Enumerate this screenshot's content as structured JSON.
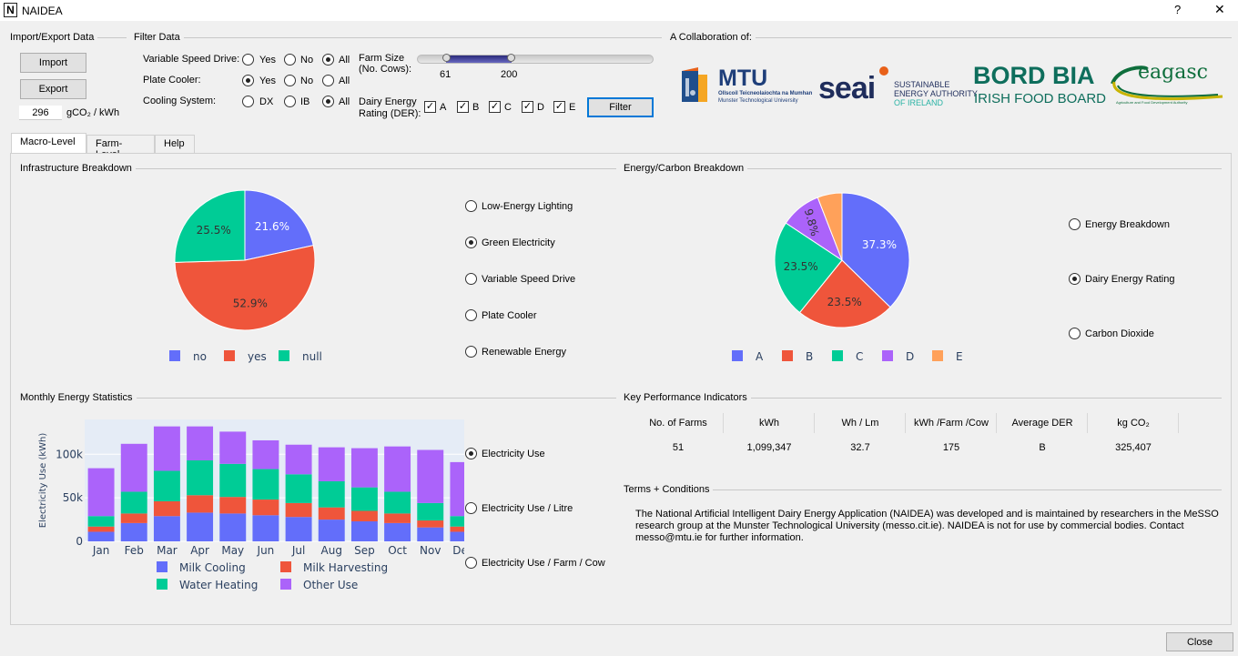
{
  "window": {
    "title": "NAIDEA",
    "help": "?",
    "close": "✕",
    "app_icon": "N"
  },
  "import_export": {
    "group": "Import/Export Data",
    "import_label": "Import",
    "export_label": "Export",
    "carbon_value": "296",
    "carbon_unit": "gCO₂ / kWh"
  },
  "filter": {
    "group": "Filter Data",
    "vsd": {
      "label": "Variable Speed Drive:",
      "options": [
        "Yes",
        "No",
        "All"
      ],
      "selected": "All"
    },
    "plate": {
      "label": "Plate Cooler:",
      "options": [
        "Yes",
        "No",
        "All"
      ],
      "selected": "Yes"
    },
    "cooling": {
      "label": "Cooling System:",
      "options": [
        "DX",
        "IB",
        "All"
      ],
      "selected": "All"
    },
    "farm_size": {
      "label_line1": "Farm Size",
      "label_line2": "(No. Cows):",
      "min": "61",
      "max": "200",
      "range_min": 0,
      "range_max": 1000
    },
    "der": {
      "label_line1": "Dairy Energy",
      "label_line2": "Rating (DER):",
      "options": [
        "A",
        "B",
        "C",
        "D",
        "E"
      ],
      "checked": [
        true,
        true,
        true,
        true,
        true
      ]
    },
    "filter_button": "Filter"
  },
  "collab": {
    "group": "A Collaboration of:",
    "mtu": {
      "name": "MTU",
      "sub1": "Ollscoil Teicneolaíochta na Mumhan",
      "sub2": "Munster Technological University"
    },
    "seai": {
      "name": "seai",
      "sub1": "SUSTAINABLE",
      "sub2": "ENERGY AUTHORITY",
      "sub3": "OF IRELAND"
    },
    "bordbia": {
      "name": "BORD BIA",
      "sub": "IRISH FOOD BOARD"
    },
    "teagasc": {
      "name": "eagasc",
      "sub": "Agriculture and Food Development Authority"
    }
  },
  "tabs": [
    {
      "label": "Macro-Level",
      "active": true
    },
    {
      "label": "Farm-Level",
      "active": false
    },
    {
      "label": "Help",
      "active": false
    }
  ],
  "infra": {
    "group": "Infrastructure Breakdown",
    "options": [
      "Low-Energy Lighting",
      "Green Electricity",
      "Variable Speed Drive",
      "Plate Cooler",
      "Renewable Energy"
    ],
    "selected": 1
  },
  "energy_carbon": {
    "group": "Energy/Carbon Breakdown",
    "options": [
      "Energy Breakdown",
      "Dairy Energy Rating",
      "Carbon Dioxide"
    ],
    "selected": 1
  },
  "monthly": {
    "group": "Monthly Energy Statistics",
    "options": [
      "Electricity Use",
      "Electricity Use / Litre",
      "Electricity Use / Farm / Cow"
    ],
    "selected": 0
  },
  "kpi": {
    "group": "Key Performance Indicators",
    "headers": [
      "No. of Farms",
      "kWh",
      "Wh / Lm",
      "kWh /Farm /Cow",
      "Average DER",
      "kg CO₂"
    ],
    "values": [
      "51",
      "1,099,347",
      "32.7",
      "175",
      "B",
      "325,407"
    ]
  },
  "terms": {
    "group": "Terms + Conditions",
    "line1": "The National Artificial Intelligent Dairy Energy Application (NAIDEA) was developed and is maintained by researchers in the MeSSO",
    "line2": "research group at the Munster Technological University (messo.cit.ie). NAIDEA is not for use by commercial bodies. Contact",
    "line3": "messo@mtu.ie for further information."
  },
  "close_button": "Close",
  "colors": {
    "blue": "#636efa",
    "red": "#ef553b",
    "green": "#00cc96",
    "purple": "#ab63fa",
    "orange": "#ffa15a",
    "plot_bg": "#e5ecf6",
    "accent": "#0078d7"
  },
  "chart_data": [
    {
      "type": "pie",
      "title": "",
      "labels": [
        "no",
        "yes",
        "null"
      ],
      "values": [
        21.6,
        52.9,
        25.5
      ],
      "value_labels": [
        "21.6%",
        "52.9%",
        "25.5%"
      ],
      "colors": [
        "#636efa",
        "#ef553b",
        "#00cc96"
      ],
      "legend": "bottom"
    },
    {
      "type": "pie",
      "title": "",
      "labels": [
        "A",
        "B",
        "C",
        "D",
        "E"
      ],
      "values": [
        37.3,
        23.5,
        23.5,
        9.8,
        5.88
      ],
      "value_labels": [
        "37.3%",
        "23.5%",
        "23.5%",
        "9.8%",
        "5.88%"
      ],
      "colors": [
        "#636efa",
        "#ef553b",
        "#00cc96",
        "#ab63fa",
        "#ffa15a"
      ],
      "legend": "bottom"
    },
    {
      "type": "bar",
      "stacked": true,
      "title": "",
      "ylabel": "Electricity Use (kWh)",
      "xlabel": "",
      "categories": [
        "Jan",
        "Feb",
        "Mar",
        "Apr",
        "May",
        "Jun",
        "Jul",
        "Aug",
        "Sep",
        "Oct",
        "Nov",
        "Dec"
      ],
      "series": [
        {
          "name": "Milk Cooling",
          "color": "#636efa",
          "values": [
            11000,
            21000,
            29000,
            33000,
            32000,
            30000,
            28000,
            25000,
            23000,
            21000,
            16000,
            11000
          ]
        },
        {
          "name": "Milk Harvesting",
          "color": "#ef553b",
          "values": [
            6000,
            11000,
            17000,
            20000,
            19000,
            18000,
            16000,
            14000,
            12000,
            11000,
            8000,
            6000
          ]
        },
        {
          "name": "Water Heating",
          "color": "#00cc96",
          "values": [
            12000,
            25000,
            35000,
            40000,
            38000,
            35000,
            33000,
            30000,
            27000,
            25000,
            20000,
            12000
          ]
        },
        {
          "name": "Other Use",
          "color": "#ab63fa",
          "values": [
            55000,
            55000,
            51000,
            39000,
            37000,
            33000,
            34000,
            39000,
            45000,
            52000,
            61000,
            62000
          ]
        }
      ],
      "yticks": [
        "0",
        "50k",
        "100k"
      ],
      "ylim": [
        0,
        140000
      ],
      "legend": "bottom"
    }
  ]
}
